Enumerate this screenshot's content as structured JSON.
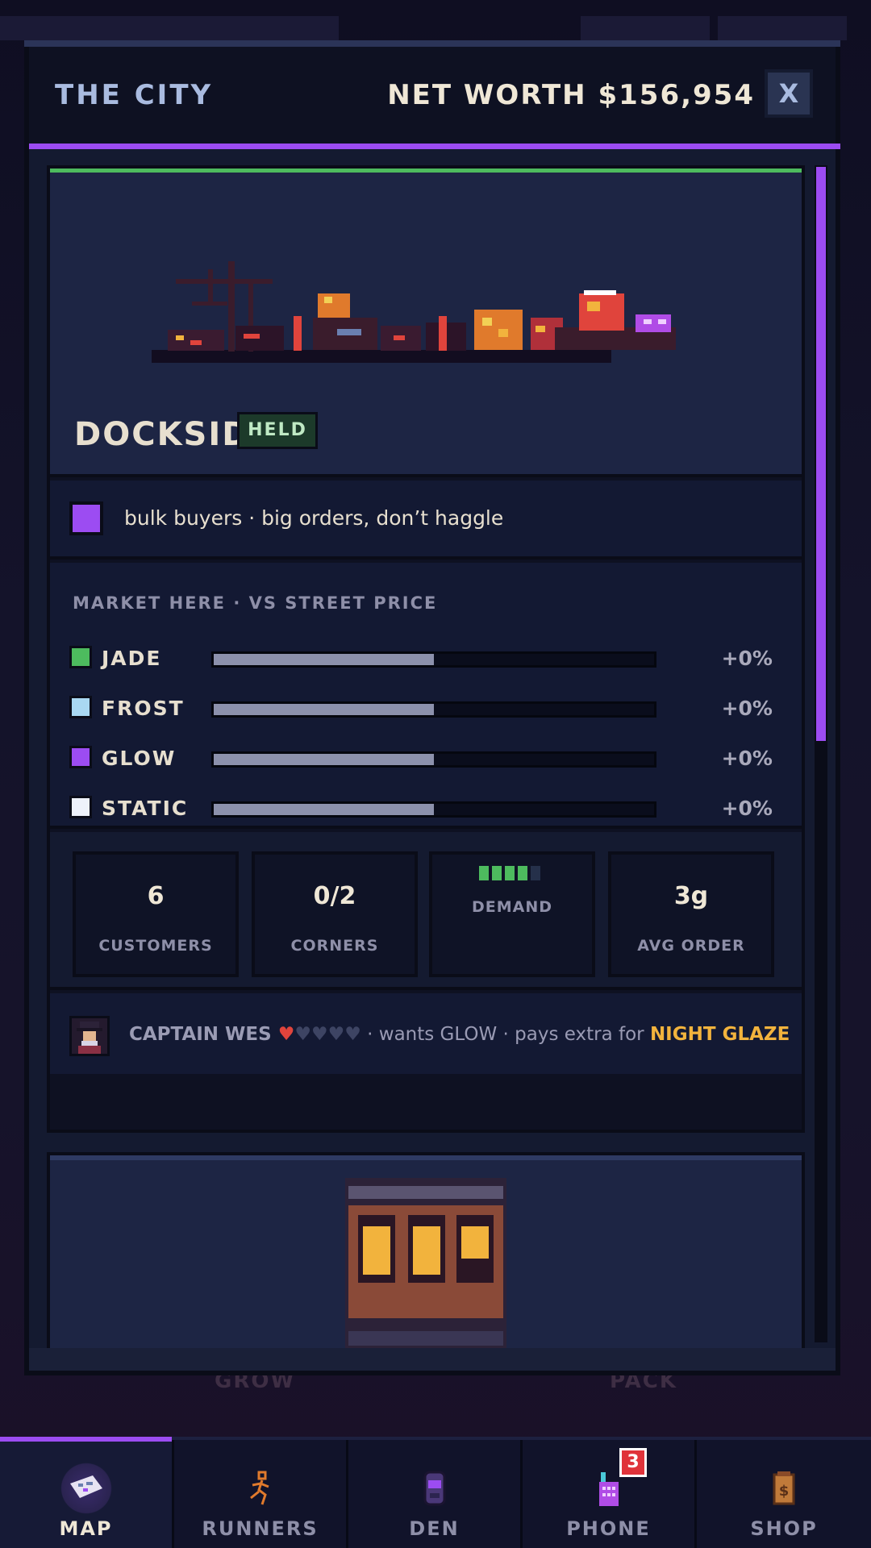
{
  "header": {
    "title": "THE CITY",
    "net_worth": "NET WORTH $156,954",
    "close_label": "X"
  },
  "district": {
    "name": "DOCKSIDE",
    "status_badge": "HELD",
    "trait": "bulk buyers · big orders, don’t haggle",
    "accent_color": "#4dbb5e",
    "trait_color": "#9c4cf2"
  },
  "market": {
    "title": "MARKET HERE · VS STREET PRICE",
    "drugs": [
      {
        "name": "JADE",
        "color": "#4dbb5e",
        "delta": "+0%",
        "level": 0.5
      },
      {
        "name": "FROST",
        "color": "#a9d8f2",
        "delta": "+0%",
        "level": 0.5
      },
      {
        "name": "GLOW",
        "color": "#9c4cf2",
        "delta": "+0%",
        "level": 0.5
      },
      {
        "name": "STATIC",
        "color": "#eef2fb",
        "delta": "+0%",
        "level": 0.5
      }
    ]
  },
  "stats": {
    "customers": {
      "value": "6",
      "label": "CUSTOMERS"
    },
    "corners": {
      "value": "0/2",
      "label": "CORNERS"
    },
    "demand": {
      "label": "DEMAND",
      "level": 4,
      "max": 5
    },
    "avg_order": {
      "value": "3g",
      "label": "AVG ORDER"
    }
  },
  "contact": {
    "name": "CAPTAIN WES",
    "hearts_filled": "♥",
    "hearts_empty": "♥♥♥♥",
    "wants": " · wants GLOW · pays extra for ",
    "special": "NIGHT GLAZE"
  },
  "background": {
    "label_left": "GROW",
    "label_right": "PACK"
  },
  "nav": {
    "items": [
      {
        "label": "MAP",
        "icon": "map-icon",
        "active": true
      },
      {
        "label": "RUNNERS",
        "icon": "runner-icon"
      },
      {
        "label": "DEN",
        "icon": "den-icon"
      },
      {
        "label": "PHONE",
        "icon": "phone-icon",
        "badge": "3"
      },
      {
        "label": "SHOP",
        "icon": "shop-bag-icon"
      }
    ]
  }
}
